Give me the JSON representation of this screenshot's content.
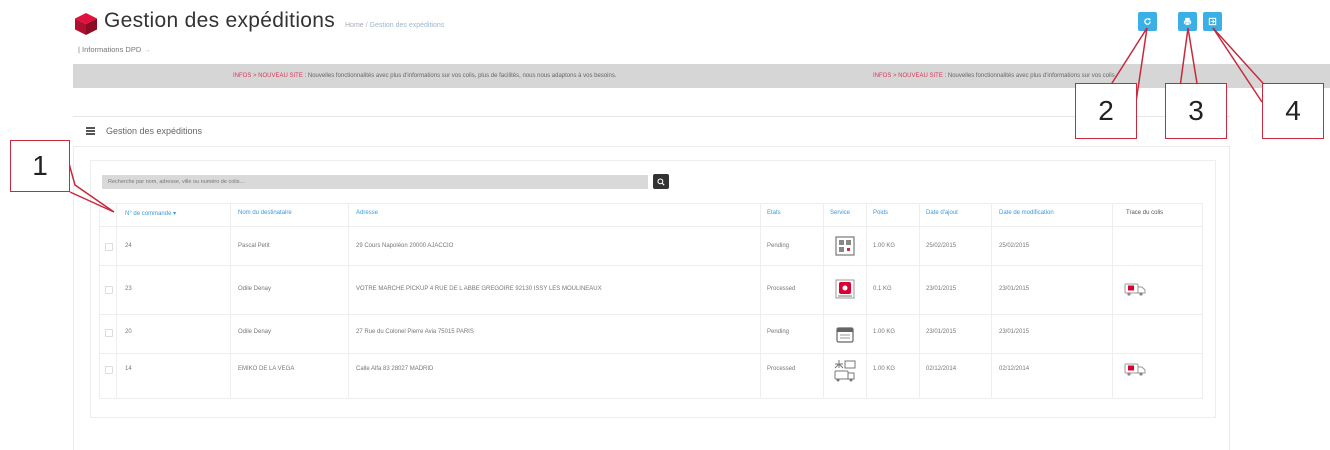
{
  "header": {
    "title": "Gestion des expéditions",
    "breadcrumb": {
      "home": "Home",
      "separator": "/",
      "current": "Gestion des expéditions"
    },
    "subnav_label": "Informations DPD",
    "subnav_arrow": "→",
    "toolbar": [
      {
        "icon": "refresh-icon"
      },
      {
        "icon": "print-icon"
      },
      {
        "icon": "export-icon"
      }
    ]
  },
  "ticker": {
    "items": [
      {
        "tag": "INFOS > NOUVEAU SITE :",
        "text": "Nouvelles fonctionnalités avec plus d'informations sur vos colis, plus de facilités, nous nous adaptons à vos besoins."
      },
      {
        "tag": "INFOS > NOUVEAU SITE :",
        "text": "Nouvelles fonctionnalités avec plus d'informations sur vos colis"
      }
    ]
  },
  "section": {
    "title": "Gestion des expéditions",
    "icon": "list-icon"
  },
  "search": {
    "placeholder": "Recherche par nom, adresse, ville ou numéro de colis…",
    "value": "",
    "button_icon": "search-icon"
  },
  "table": {
    "columns": [
      "N° de commande ▾",
      "Nom du destinataire",
      "Adresse",
      "Etats",
      "Service",
      "Poids",
      "Date d'ajout",
      "Date de modification",
      "Trace du colis"
    ],
    "rows": [
      {
        "order": "24",
        "name": "Pascal Petit",
        "address": "29 Cours Napoléon 20000 AJACCIO",
        "state": "Pending",
        "service": "classic",
        "weight": "1.00 KG",
        "added": "25/02/2015",
        "modified": "25/02/2015",
        "trace": false
      },
      {
        "order": "23",
        "name": "Odile Denay",
        "address": "VOTRE MARCHE PICKUP 4 RUE DE L ABBE GREGOIRE 92130 ISSY LES MOULINEAUX",
        "state": "Processed",
        "service": "relais",
        "weight": "0.1 KG",
        "added": "23/01/2015",
        "modified": "23/01/2015",
        "trace": true
      },
      {
        "order": "20",
        "name": "Odile Denay",
        "address": "27 Rue du Colonel Pierre Avia 75015 PARIS",
        "state": "Pending",
        "service": "predict",
        "weight": "1.00 KG",
        "added": "23/01/2015",
        "modified": "23/01/2015",
        "trace": false
      },
      {
        "order": "14",
        "name": "EMIKO DE LA VEGA",
        "address": "Calle Alfa 83 28027 MADRID",
        "state": "Processed",
        "service": "international",
        "weight": "1.00 KG",
        "added": "02/12/2014",
        "modified": "02/12/2014",
        "trace": true
      }
    ]
  },
  "callouts": [
    "1",
    "2",
    "3",
    "4"
  ],
  "colors": {
    "accent": "#3ab0e6",
    "callout": "#c8293c",
    "logo": "#dc0032",
    "link": "#3a9ad9"
  }
}
